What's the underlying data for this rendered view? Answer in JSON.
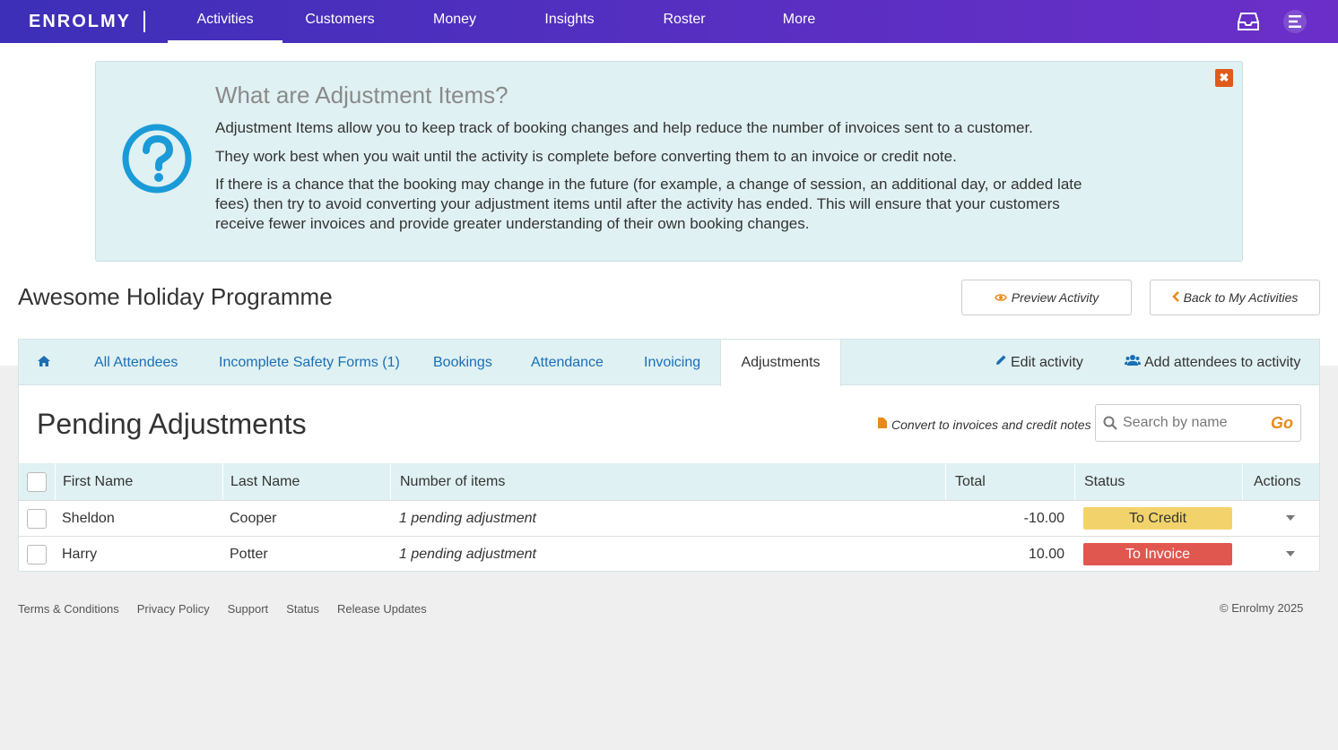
{
  "app": {
    "logo_text": "ENROLMY"
  },
  "nav": {
    "items": [
      {
        "label": "Activities"
      },
      {
        "label": "Customers"
      },
      {
        "label": "Money"
      },
      {
        "label": "Insights"
      },
      {
        "label": "Roster"
      },
      {
        "label": "More"
      }
    ],
    "active_index": 0
  },
  "info_box": {
    "title": "What are Adjustment Items?",
    "paragraphs": [
      "Adjustment Items allow you to keep track of booking changes and help reduce the number of invoices sent to a customer.",
      "They work best when you wait until the activity is complete before converting them to an invoice or credit note.",
      "If there is a chance that the booking may change in the future (for example, a change of session, an additional day, or added late fees) then try to avoid converting your adjustment items until after the activity has ended. This will ensure that your customers receive fewer invoices and provide greater understanding of their own booking changes."
    ],
    "close_label": "✖"
  },
  "activity": {
    "title": "Awesome Holiday Programme",
    "preview_label": "Preview Activity",
    "back_label": "Back to My Activities"
  },
  "tabs": {
    "items": [
      {
        "label": "All Attendees"
      },
      {
        "label": "Incomplete Safety Forms (1)"
      },
      {
        "label": "Bookings"
      },
      {
        "label": "Attendance"
      },
      {
        "label": "Invoicing"
      },
      {
        "label": "Adjustments"
      }
    ],
    "active_label": "Adjustments",
    "edit_label": "Edit activity",
    "add_label": "Add attendees to activity"
  },
  "adjustments": {
    "title": "Pending Adjustments",
    "convert_label": "Convert to invoices and credit notes",
    "search_placeholder": "Search by name",
    "go_label": "Go"
  },
  "table": {
    "headers": {
      "first_name": "First Name",
      "last_name": "Last Name",
      "items": "Number of items",
      "total": "Total",
      "status": "Status",
      "actions": "Actions"
    },
    "rows": [
      {
        "first_name": "Sheldon",
        "last_name": "Cooper",
        "items": "1 pending adjustment",
        "total": "-10.00",
        "status": "To Credit"
      },
      {
        "first_name": "Harry",
        "last_name": "Potter",
        "items": "1 pending adjustment",
        "total": "10.00",
        "status": "To Invoice"
      }
    ]
  },
  "colors": {
    "to_credit": "#f2d36b",
    "to_invoice": "#e0574f",
    "accent_orange": "#e88a1a",
    "link_blue": "#1a6fb5"
  },
  "footer": {
    "links": [
      {
        "label": "Terms & Conditions"
      },
      {
        "label": "Privacy Policy"
      },
      {
        "label": "Support"
      },
      {
        "label": "Status"
      },
      {
        "label": "Release Updates"
      }
    ],
    "copyright": "© Enrolmy 2025"
  }
}
